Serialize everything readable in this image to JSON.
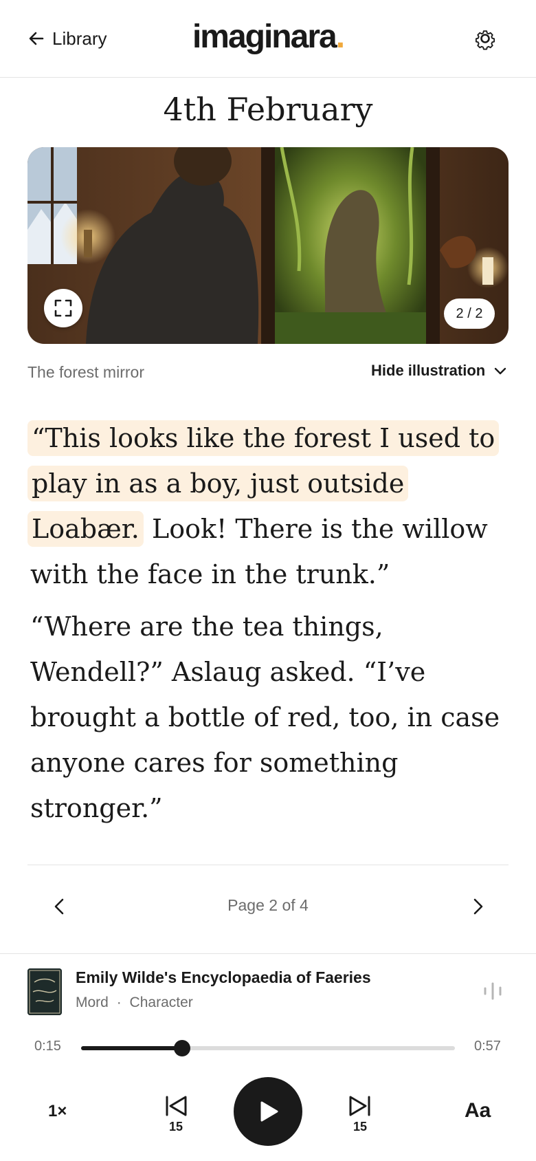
{
  "header": {
    "back_label": "Library",
    "logo_text": "imaginara",
    "logo_dot": ".",
    "logo_dot_color": "#f0a93c"
  },
  "chapter": {
    "title": "4th February"
  },
  "illustration": {
    "counter": "2 / 2",
    "caption": "The forest mirror",
    "toggle_label": "Hide illustration"
  },
  "story": {
    "highlighted": "“This looks like the forest I used to play in as a boy, just outside Loabær.",
    "p1_rest": " Look! There is the willow with the face in the trunk.”",
    "p2": "“Where are the tea things, Wendell?” Aslaug asked. “I’ve brought a bottle of red, too, in case anyone cares for something stronger.”",
    "highlight_color": "#fdf0df"
  },
  "pagination": {
    "label": "Page 2 of 4"
  },
  "player": {
    "book_title": "Emily Wilde's Encyclopaedia of Faeries",
    "voice": "Mord",
    "separator": "·",
    "mode": "Character",
    "elapsed": "0:15",
    "duration": "0:57",
    "progress": 0.27,
    "speed": "1×",
    "skip_back_seconds": "15",
    "skip_forward_seconds": "15",
    "text_settings_label": "Aa"
  }
}
